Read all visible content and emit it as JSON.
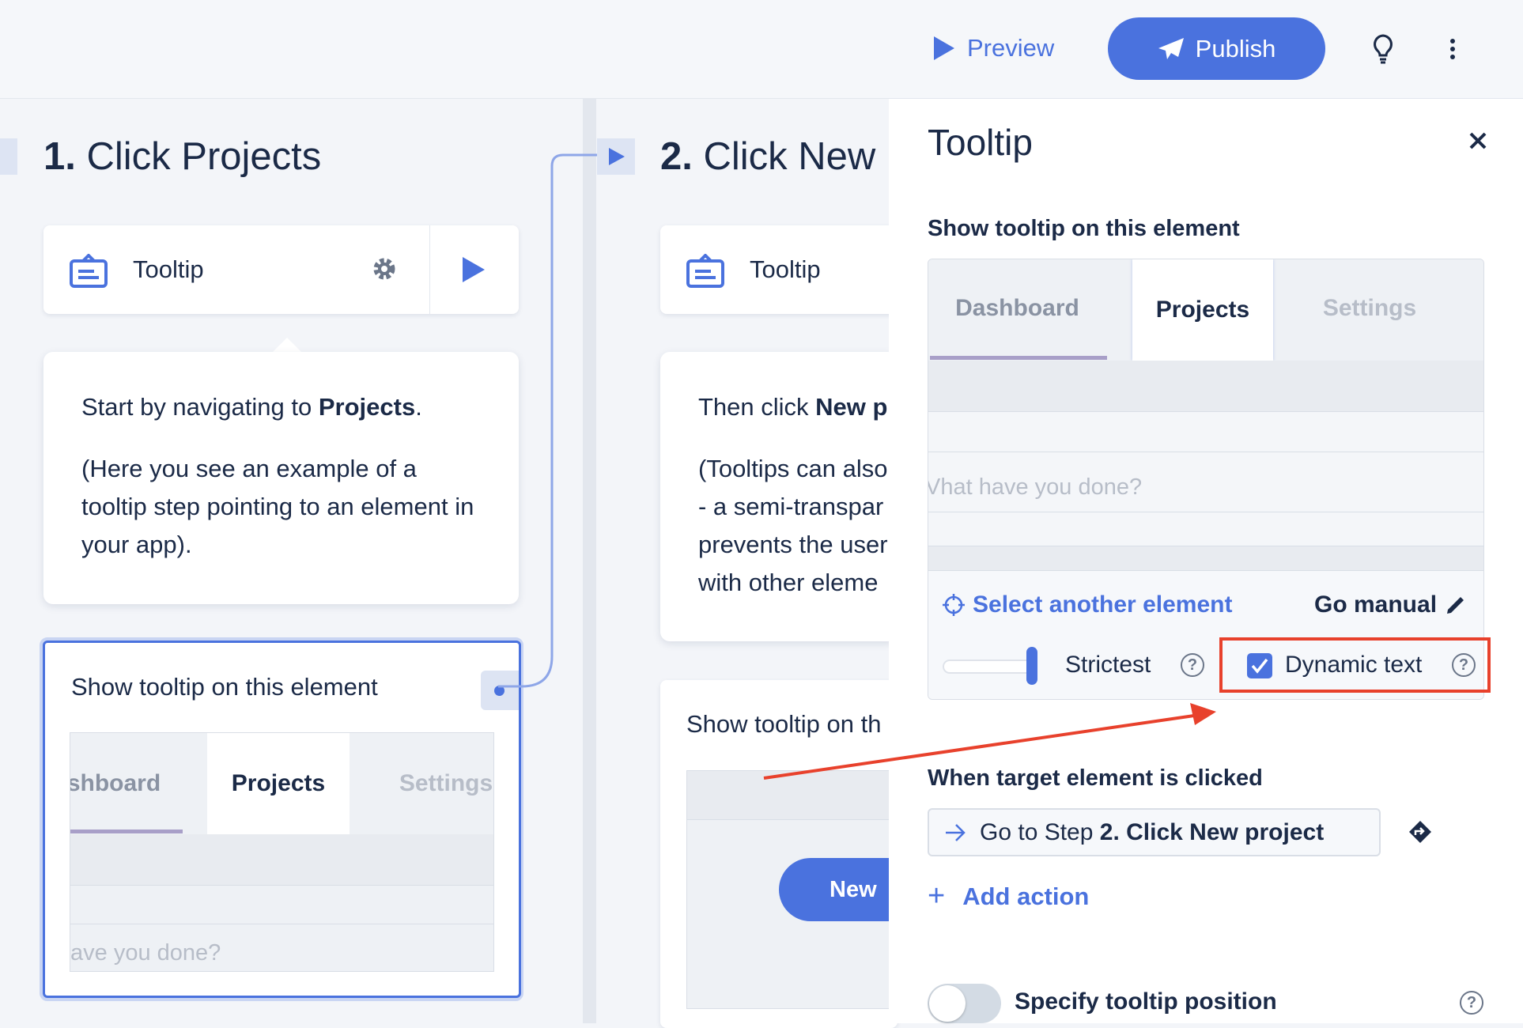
{
  "topbar": {
    "preview": "Preview",
    "publish": "Publish",
    "bulb_icon": "lightbulb-icon",
    "more_icon": "kebab-icon"
  },
  "steps": [
    {
      "number": "1.",
      "title": "Click Projects",
      "card_label": "Tooltip",
      "bubble_pre": "Start by navigating to ",
      "bubble_bold": "Projects",
      "bubble_post": ".",
      "bubble_p2": "(Here you see an example of a tooltip step pointing to an element in your app).",
      "element_label": "Show tooltip on this element",
      "mini_tabs": [
        "shboard",
        "Projects",
        "Settings"
      ],
      "mini_placeholder": "ave you done?"
    },
    {
      "number": "2.",
      "title": "Click New p",
      "card_label": "Tooltip",
      "bubble_pre": "Then click ",
      "bubble_bold": "New p",
      "bubble_p2_lines": [
        "(Tooltips can also",
        "- a semi-transpar",
        "prevents the user",
        "with other eleme"
      ],
      "element_label": "Show tooltip on th",
      "new_button": "New"
    }
  ],
  "panel": {
    "title": "Tooltip",
    "section_label": "Show tooltip on this element",
    "tabs": [
      "Dashboard",
      "Projects",
      "Settings"
    ],
    "placeholder": "Vhat have you done?",
    "select_another": "Select another element",
    "go_manual": "Go manual",
    "strictness_label": "Strictest",
    "strictness_level": 1.0,
    "dynamic_text": "Dynamic text",
    "dynamic_text_checked": true,
    "when_clicked_label": "When target element is clicked",
    "action_prefix": "Go to Step ",
    "action_target": "2. Click New project",
    "add_action": "Add action",
    "specify_position": "Specify tooltip position",
    "specify_position_on": false
  },
  "colors": {
    "accent": "#4a72de",
    "text": "#1b2a47",
    "annotation": "#e8412c",
    "tab_underline": "#a89fc8"
  }
}
